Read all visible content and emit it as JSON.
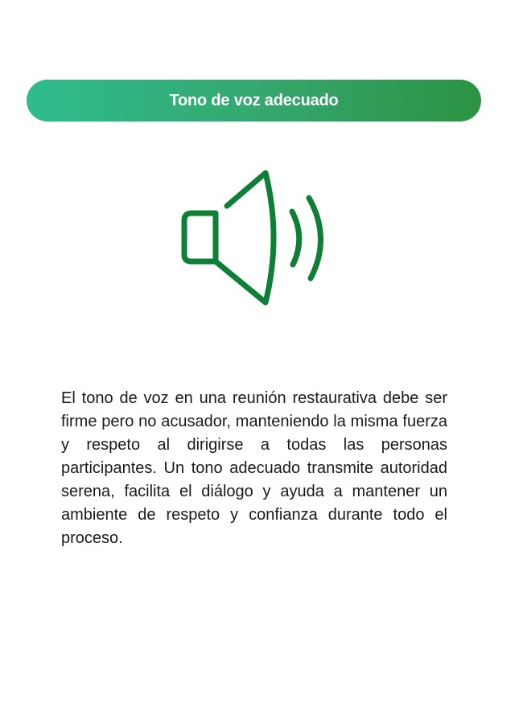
{
  "header": {
    "title": "Tono de voz adecuado"
  },
  "illustration": {
    "icon": "speaker-volume-icon",
    "color": "#0f7f38"
  },
  "content": {
    "paragraph": "El tono de voz en una reunión restaurativa debe ser firme pero no acusador, manteniendo la misma fuerza y respeto al dirigirse a todas las personas participantes. Un tono adecuado transmite autoridad serena, facilita el diálogo y ayuda a mantener un ambiente de respeto y confianza durante todo el proceso."
  },
  "colors": {
    "banner_start": "#2ebc8c",
    "banner_end": "#2b9342",
    "banner_text": "#ffffff",
    "body_text": "#1a1a1a"
  }
}
